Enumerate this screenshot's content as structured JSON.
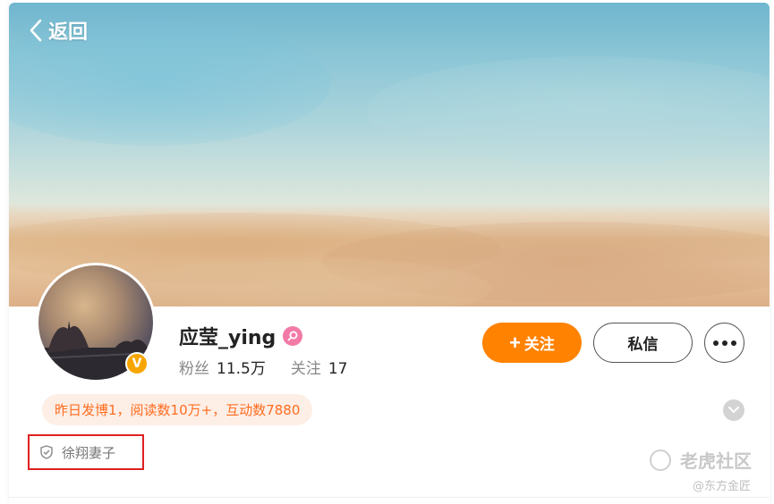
{
  "nav": {
    "back_label": "返回"
  },
  "profile": {
    "name": "应莹_ying",
    "verified_mark": "V",
    "gender_icon": "female-icon",
    "fans_label": "粉丝",
    "fans_value": "11.5万",
    "following_label": "关注",
    "following_value": "17"
  },
  "actions": {
    "follow_label": "关注",
    "message_label": "私信"
  },
  "activity": {
    "text": "昨日发博1，阅读数10万+，互动数7880"
  },
  "tag": {
    "text": "徐翔妻子"
  },
  "watermark": {
    "main": "老虎社区",
    "sub": "@东方金匠"
  },
  "colors": {
    "accent": "#ff8200",
    "activity_text": "#ff6d1f",
    "activity_bg": "#fdeee6",
    "verified": "#f7a600",
    "gender": "#f37aa7",
    "highlight_box": "#e02020"
  }
}
